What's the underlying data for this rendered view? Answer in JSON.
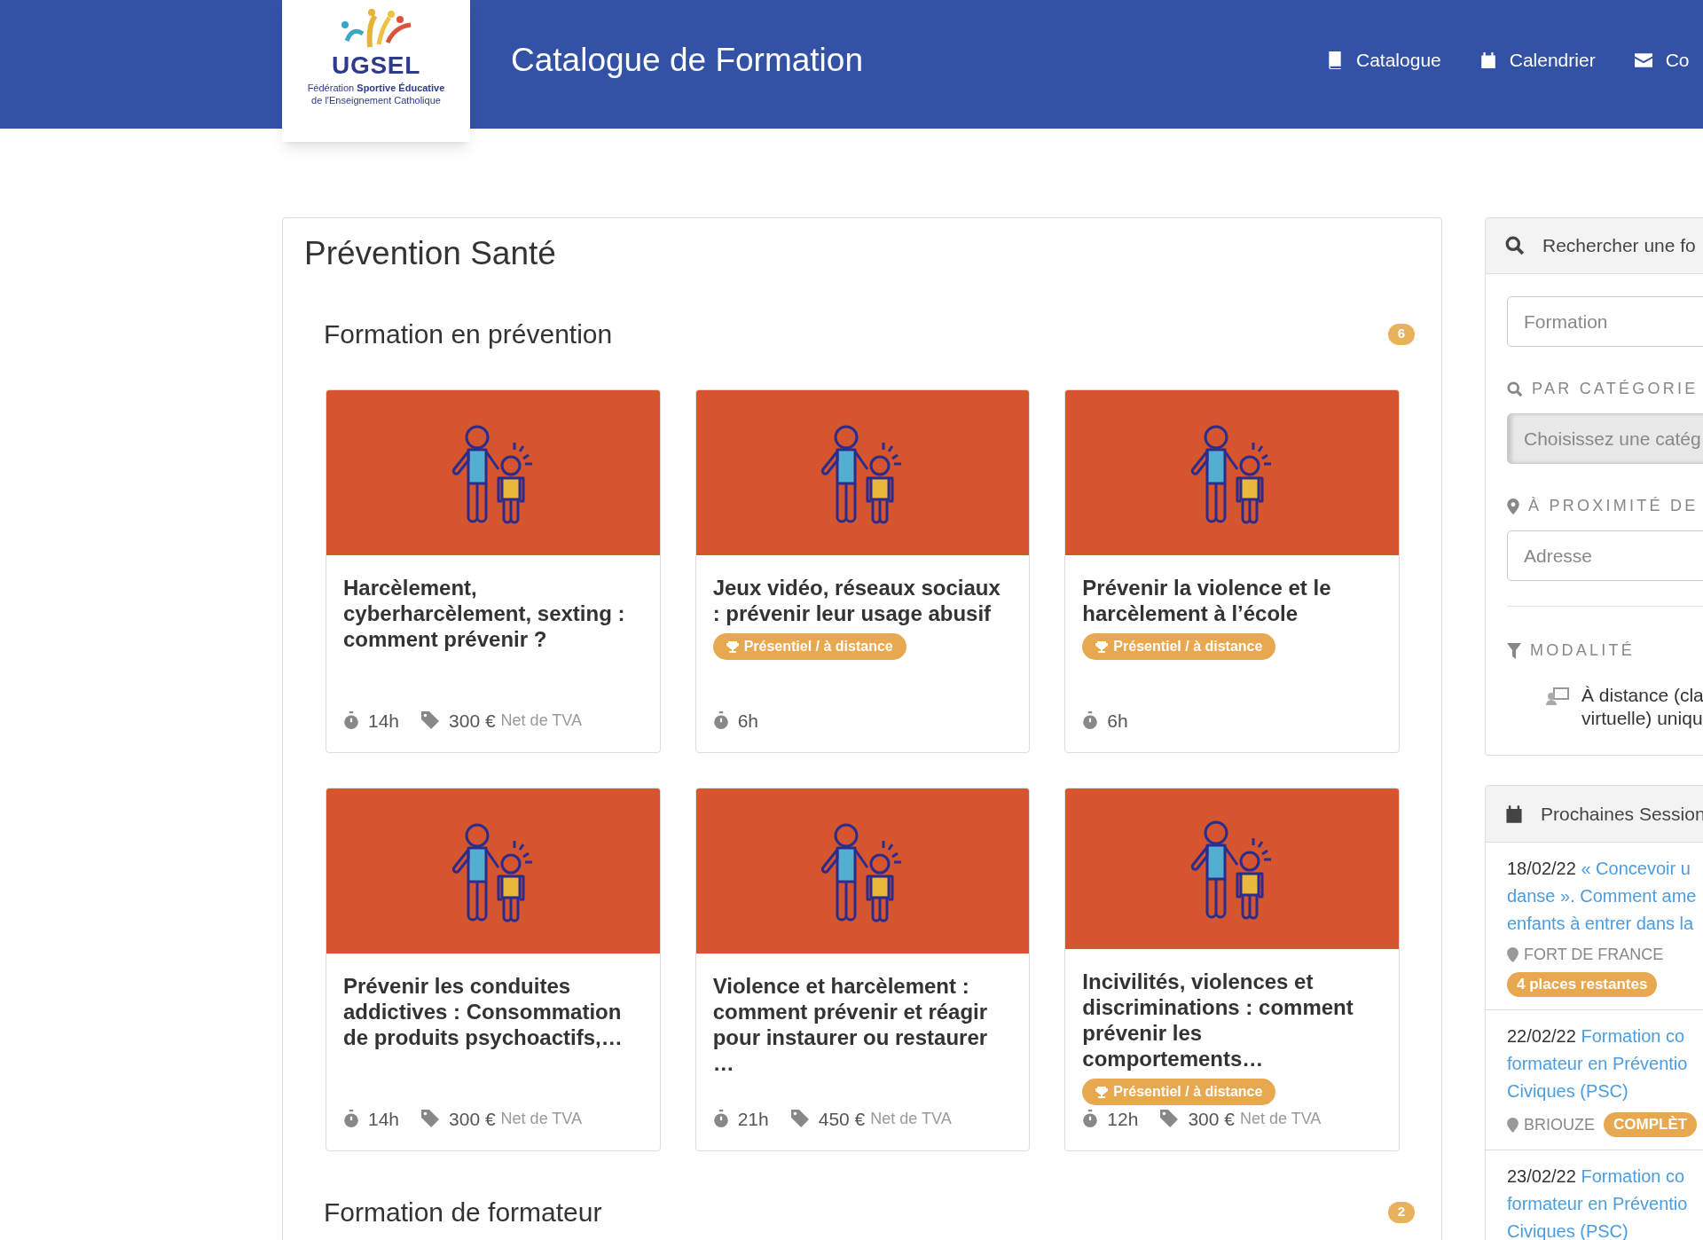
{
  "header": {
    "logo": {
      "name": "UGSEL",
      "tagline_1": "Fédération **Sportive Éducative**",
      "tagline_2": "de l'Enseignement Catholique"
    },
    "title": "Catalogue de Formation",
    "nav": [
      {
        "label": "Catalogue"
      },
      {
        "label": "Calendrier"
      },
      {
        "label": "Co"
      }
    ]
  },
  "main": {
    "title": "Prévention Santé",
    "sections": [
      {
        "title": "Formation en prévention",
        "count": "6",
        "cards": [
          {
            "title": "Harcèlement, cyberharcèlement, sexting : comment prévenir ?",
            "duration": "14h",
            "price": "300 €",
            "price_note": "Net de TVA"
          },
          {
            "title": "Jeux vidéo, réseaux sociaux : prévenir leur usage abusif",
            "modality": "Présentiel / à distance",
            "duration": "6h"
          },
          {
            "title": "Prévenir la violence et le harcèlement à l’école",
            "modality": "Présentiel / à distance",
            "duration": "6h"
          },
          {
            "title": "Prévenir les conduites addictives : Consommation de produits psychoactifs,…",
            "duration": "14h",
            "price": "300 €",
            "price_note": "Net de TVA"
          },
          {
            "title": "Violence et harcèlement : comment prévenir et réagir pour instaurer ou restaurer …",
            "duration": "21h",
            "price": "450 €",
            "price_note": "Net de TVA"
          },
          {
            "title": "Incivilités, violences et discriminations : comment prévenir les comportements…",
            "modality": "Présentiel / à distance",
            "duration": "12h",
            "price": "300 €",
            "price_note": "Net de TVA"
          }
        ]
      },
      {
        "title": "Formation de formateur",
        "count": "2"
      }
    ]
  },
  "search_panel": {
    "title": "Rechercher une fo",
    "formation_field": {
      "placeholder": "Formation"
    },
    "category_label": "PAR CATÉGORIE",
    "category_select": {
      "placeholder": "Choisissez une catég",
      "disabled": true
    },
    "proximity_label": "À PROXIMITÉ DE",
    "address_field": {
      "placeholder": "Adresse"
    },
    "modality_label": "MODALITÉ",
    "modality_options": [
      {
        "lines": [
          "À distance (cla",
          "virtuelle) uniqu"
        ]
      }
    ]
  },
  "sessions_panel": {
    "title": "Prochaines Session",
    "sessions": [
      {
        "date": "18/02/22",
        "link_lines": [
          "« Concevoir u",
          "danse ». Comment ame",
          "enfants à entrer dans la"
        ],
        "place": "FORT DE FRANCE",
        "badge": "4 places restantes"
      },
      {
        "date": "22/02/22",
        "link_lines": [
          "Formation co",
          "formateur en Préventio",
          "Civiques (PSC)"
        ],
        "place": "BRIOUZE",
        "badge": "COMPLÈT"
      },
      {
        "date": "23/02/22",
        "link_lines": [
          "Formation co",
          "formateur en Préventio",
          "Civiques (PSC)"
        ]
      }
    ]
  }
}
